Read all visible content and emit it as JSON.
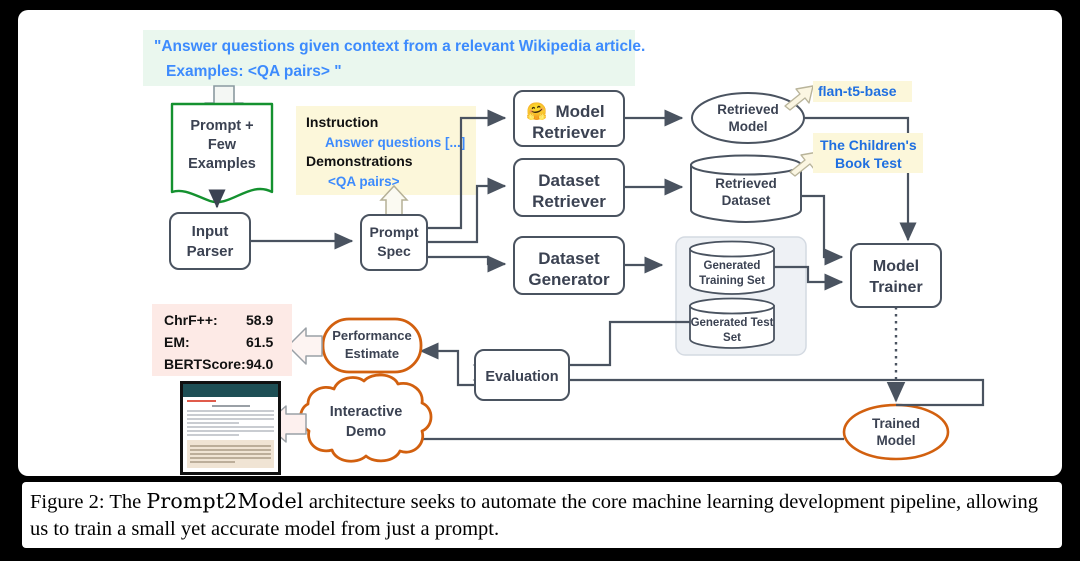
{
  "figure": {
    "caption_prefix": "Figure 2:",
    "caption_a": " The ",
    "caption_name": "Prompt2Model",
    "caption_b": " architecture seeks to automate the core machine learning development pipeline, allowing us to train a small yet accurate model from just a prompt."
  },
  "prompt_banner": {
    "line1": "\"Answer questions given context from a relevant Wikipedia article.",
    "line2": "Examples: <QA pairs> \"",
    "bg": "#eaf7ee",
    "text_color": "#3d8bfd"
  },
  "prompt_doc": {
    "line1": "Prompt +",
    "line2": "Few",
    "line3": "Examples",
    "border": "#14912f"
  },
  "prompt_spec_panel": {
    "heading1": "Instruction",
    "value1": "Answer questions [...]",
    "heading2": "Demonstrations",
    "value2": "<QA pairs>",
    "bg": "#fcf7da"
  },
  "nodes": {
    "input_parser": {
      "line1": "Input",
      "line2": "Parser"
    },
    "prompt_spec": {
      "line1": "Prompt",
      "line2": "Spec"
    },
    "model_retriever": {
      "icon": "hugging-face-emoji",
      "line1": "Model",
      "line2": "Retriever"
    },
    "dataset_retriever": {
      "line1": "Dataset",
      "line2": "Retriever"
    },
    "dataset_generator": {
      "line1": "Dataset",
      "line2": "Generator"
    },
    "retrieved_model": {
      "line1": "Retrieved",
      "line2": "Model"
    },
    "retrieved_dataset": {
      "line1": "Retrieved",
      "line2": "Dataset"
    },
    "generated_training_set": {
      "line1": "Generated",
      "line2": "Training Set"
    },
    "generated_test_set": {
      "line1": "Generated Test",
      "line2": "Set"
    },
    "model_trainer": {
      "line1": "Model",
      "line2": "Trainer"
    },
    "trained_model": {
      "line1": "Trained",
      "line2": "Model"
    },
    "evaluation": {
      "line1": "Evaluation"
    },
    "performance_estimate": {
      "line1": "Performance",
      "line2": "Estimate"
    },
    "interactive_demo": {
      "line1": "Interactive",
      "line2": "Demo"
    }
  },
  "callouts": {
    "model_name": "flan-t5-base",
    "dataset_name_line1": "The Children's",
    "dataset_name_line2": "Book Test",
    "bg": "#fcf7da",
    "text_color": "#1f6fe0"
  },
  "metrics": {
    "bg": "#fdeae6",
    "rows": [
      {
        "label": "ChrF++:",
        "value": "58.9"
      },
      {
        "label": "EM:",
        "value": "61.5"
      },
      {
        "label": "BERTScore:",
        "value": "94.0"
      }
    ]
  },
  "colors": {
    "stroke": "#4a5360",
    "orange": "#d2600f",
    "green": "#14912f",
    "node_fill": "#ffffff",
    "group_fill": "#eef1f5"
  }
}
